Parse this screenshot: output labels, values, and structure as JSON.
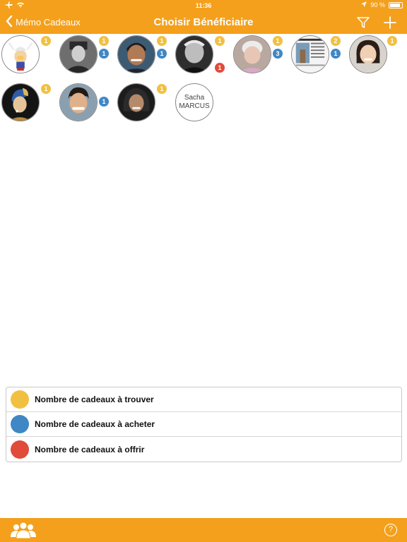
{
  "status_bar": {
    "time": "11:36",
    "battery": "90 %",
    "battery_level": 0.9
  },
  "nav": {
    "back_label": "Mémo Cadeaux",
    "title": "Choisir Bénéficiaire",
    "filter_icon": "filter-icon",
    "add_icon": "plus-icon"
  },
  "colors": {
    "accent": "#f4a01c",
    "to_find": "#f2c040",
    "to_buy": "#3f88c5",
    "to_offer": "#e04b3a"
  },
  "beneficiaries": [
    {
      "name": "asterix",
      "badges": {
        "find": "1"
      }
    },
    {
      "name": "de-gaulle",
      "badges": {
        "find": "1",
        "buy": "1"
      }
    },
    {
      "name": "man-smiling",
      "badges": {
        "find": "1",
        "buy": "1"
      }
    },
    {
      "name": "old-man",
      "badges": {
        "find": "1",
        "offer": "1"
      }
    },
    {
      "name": "old-woman",
      "badges": {
        "find": "1",
        "buy": "3"
      }
    },
    {
      "name": "magazine",
      "badges": {
        "find": "2",
        "buy": "1"
      }
    },
    {
      "name": "woman-smiling",
      "badges": {
        "find": "1"
      }
    },
    {
      "name": "pearl-earring",
      "badges": {
        "find": "1"
      }
    },
    {
      "name": "young-man",
      "badges": {
        "buy": "1"
      }
    },
    {
      "name": "woman-hooded",
      "badges": {
        "find": "1"
      }
    },
    {
      "name": "sacha-marcus",
      "initials_line1": "Sacha",
      "initials_line2": "MARCUS",
      "badges": {}
    }
  ],
  "legend": [
    {
      "label": "Nombre de cadeaux à trouver",
      "color": "#f2c040"
    },
    {
      "label": "Nombre de cadeaux à acheter",
      "color": "#3f88c5"
    },
    {
      "label": "Nombre de cadeaux à offrir",
      "color": "#e04b3a"
    }
  ],
  "tab_bar": {
    "help_label": "?"
  }
}
